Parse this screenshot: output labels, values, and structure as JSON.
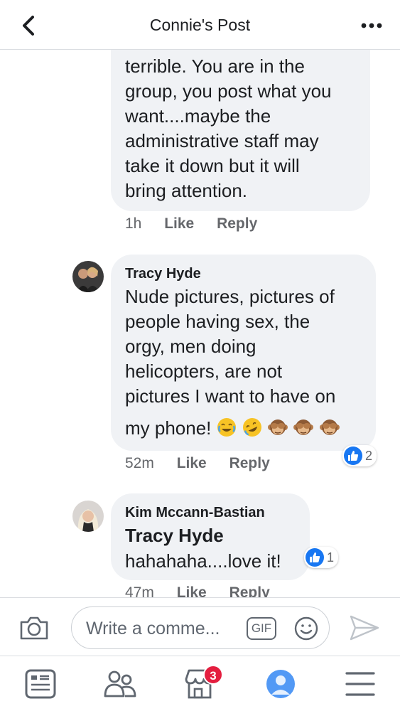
{
  "header": {
    "title": "Connie's Post"
  },
  "comments": [
    {
      "text_lines": [
        "terrible. You are in the",
        "group, you post what you",
        "want....maybe the",
        "administrative staff may",
        "take it down but it will",
        "bring attention."
      ],
      "time": "1h",
      "like_label": "Like",
      "reply_label": "Reply"
    },
    {
      "author": "Tracy Hyde",
      "text_lines": [
        "Nude pictures, pictures of",
        "people having sex, the",
        "orgy, men doing",
        "helicopters, are not",
        "pictures I want to have on"
      ],
      "last_line": "my phone!",
      "emojis": [
        "joy-emoji",
        "rofl-emoji",
        "see-no-evil-monkey-emoji",
        "see-no-evil-monkey-emoji",
        "see-no-evil-monkey-emoji"
      ],
      "time": "52m",
      "like_label": "Like",
      "reply_label": "Reply",
      "reaction_count": "2"
    },
    {
      "author": "Kim Mccann-Bastian",
      "tag": "Tracy Hyde",
      "text": "hahahaha....love it!",
      "time": "47m",
      "like_label": "Like",
      "reply_label": "Reply",
      "reaction_count": "1"
    }
  ],
  "composer": {
    "placeholder": "Write a comme...",
    "gif_label": "GIF"
  },
  "tabbar": {
    "marketplace_badge": "3"
  },
  "colors": {
    "accent": "#1877f2",
    "bubble": "#f0f2f5",
    "badge": "#e41e3f",
    "meta": "#65676b"
  }
}
